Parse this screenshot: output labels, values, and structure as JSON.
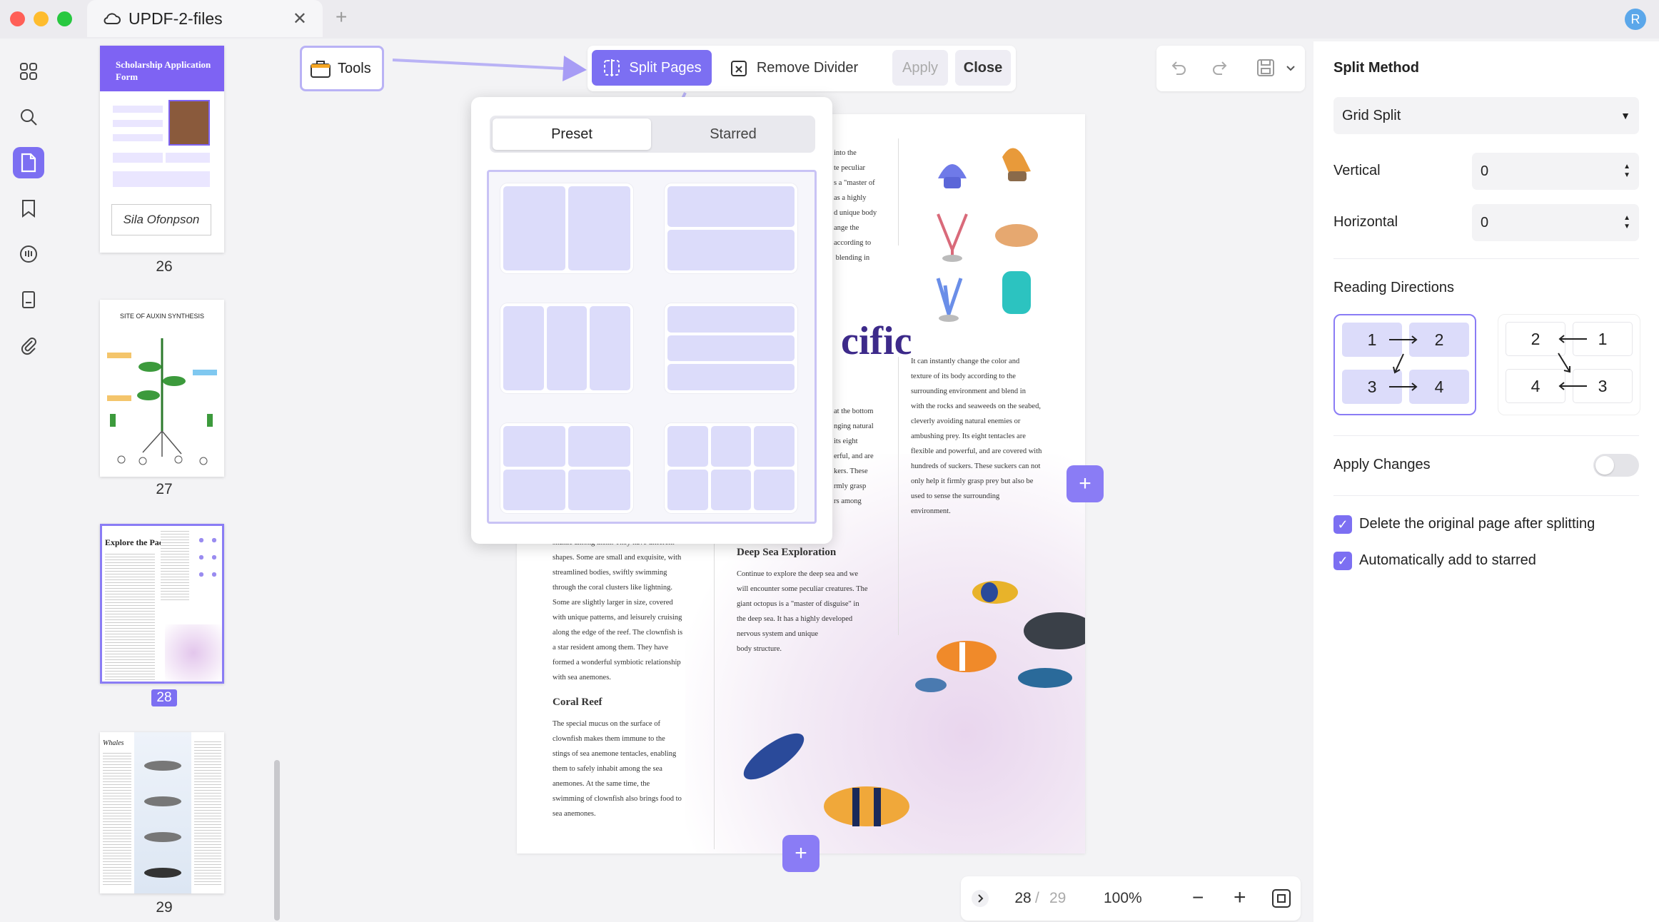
{
  "window": {
    "tab_title": "UPDF-2-files",
    "tab_close": "✕",
    "new_tab": "+",
    "user_initial": "R"
  },
  "rail": {
    "icons": [
      "grid-icon",
      "search-icon",
      "pages-icon",
      "bookmark-icon",
      "comment-icon",
      "document-icon",
      "attachment-icon"
    ]
  },
  "thumbnails": [
    {
      "page": "26",
      "title": "Scholarship Application Form",
      "signature": "Sila Ofonpson"
    },
    {
      "page": "27",
      "title": "SITE OF AUXIN SYNTHESIS"
    },
    {
      "page": "28",
      "title": "Explore the Pacific",
      "selected": true
    },
    {
      "page": "29",
      "title": "Whales"
    }
  ],
  "toolbar": {
    "tools_label": "Tools",
    "split_pages_label": "Split Pages",
    "remove_divider_label": "Remove Divider",
    "apply_label": "Apply",
    "close_label": "Close"
  },
  "popup": {
    "tabs": [
      "Preset",
      "Starred"
    ],
    "active_tab": "Preset",
    "presets": [
      "2 columns",
      "2 rows",
      "3 columns",
      "3 rows",
      "2x2 grid",
      "3x2 grid"
    ]
  },
  "page_content": {
    "col1_top": "into the\nte peculiar\ns a \"master of\nas a highly\nd unique body\nange the\naccording to\n blending in",
    "heading_fragment": "cific",
    "col1_mid": "at the bottom\nnging natural\nits eight\nerful, and are\nkers. These\nrmly grasp\nrs among",
    "col2_para": "It can instantly change the color and\ntexture of its body according to the\nsurrounding environment and blend in\nwith the rocks and seaweeds on the seabed,\ncleverly avoiding natural enemies or\nambushing prey. Its eight tentacles are\nflexible and powerful, and are covered with\nhundreds of suckers. These suckers can not\nonly help it firmly grasp prey but also be\nused to sense the surrounding\nenvironment.",
    "left_para": "shuttle among them. They have different\nshapes. Some are small and exquisite, with\nstreamlined bodies, swiftly swimming\nthrough the coral clusters like lightning.\nSome are slightly larger in size, covered\nwith unique patterns, and leisurely cruising\nalong the edge of the reef. The clownfish is\na star resident among them. They have\nformed a wonderful symbiotic relationship\nwith sea anemones.",
    "coral_heading": "Coral Reef",
    "coral_para": "The special mucus on the surface of\nclownfish makes them immune to the\nstings of sea anemone tentacles, enabling\nthem to safely inhabit among the sea\nanemones. At the same time, the\nswimming of clownfish also brings food to\nsea anemones.",
    "deep_heading": "Deep Sea Exploration",
    "deep_para": "Continue to explore the deep sea and we\nwill encounter some peculiar creatures. The\ngiant octopus is a \"master of disguise\" in\nthe deep sea. It has a highly developed\nnervous system and unique\nbody structure."
  },
  "bottombar": {
    "current_page": "28",
    "separator": "/",
    "total_pages": "29",
    "zoom": "100%",
    "zoom_out": "−",
    "zoom_in": "+"
  },
  "panel": {
    "split_method_title": "Split Method",
    "split_method_value": "Grid Split",
    "vertical_label": "Vertical",
    "vertical_value": "0",
    "horizontal_label": "Horizontal",
    "horizontal_value": "0",
    "reading_title": "Reading Directions",
    "dir1": [
      "1",
      "2",
      "3",
      "4"
    ],
    "dir2": [
      "2",
      "1",
      "4",
      "3"
    ],
    "apply_changes_label": "Apply Changes",
    "apply_changes_on": false,
    "option1_label": "Delete the original page after splitting",
    "option1_checked": true,
    "option2_label": "Automatically add to starred",
    "option2_checked": true
  },
  "colors": {
    "accent": "#7c6ff2",
    "accent_light": "#dcdcfa",
    "highlight_border": "#b9b2f5"
  }
}
